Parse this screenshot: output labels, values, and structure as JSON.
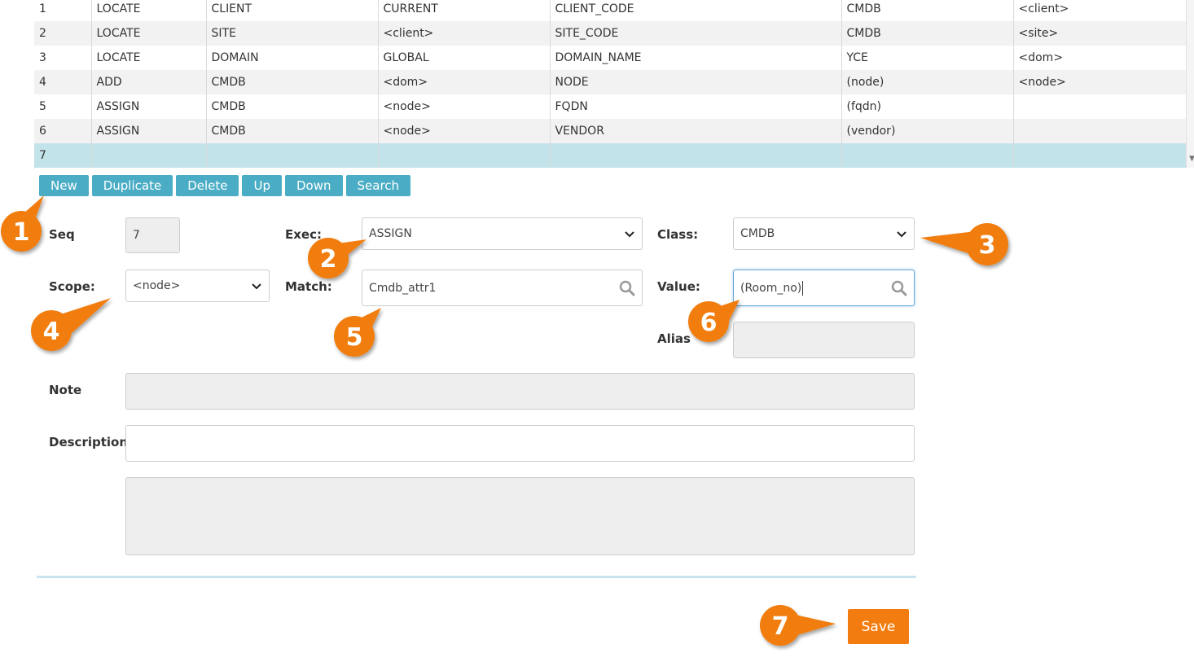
{
  "table": {
    "rows": [
      {
        "seq": "1",
        "exec": "LOCATE",
        "class": "CLIENT",
        "scope": "CURRENT",
        "match": "CLIENT_CODE",
        "value": "CMDB",
        "alias": "<client>"
      },
      {
        "seq": "2",
        "exec": "LOCATE",
        "class": "SITE",
        "scope": "<client>",
        "match": "SITE_CODE",
        "value": "CMDB",
        "alias": "<site>"
      },
      {
        "seq": "3",
        "exec": "LOCATE",
        "class": "DOMAIN",
        "scope": "GLOBAL",
        "match": "DOMAIN_NAME",
        "value": "YCE",
        "alias": "<dom>"
      },
      {
        "seq": "4",
        "exec": "ADD",
        "class": "CMDB",
        "scope": "<dom>",
        "match": "NODE",
        "value": "(node)",
        "alias": "<node>"
      },
      {
        "seq": "5",
        "exec": "ASSIGN",
        "class": "CMDB",
        "scope": "<node>",
        "match": "FQDN",
        "value": "(fqdn)",
        "alias": ""
      },
      {
        "seq": "6",
        "exec": "ASSIGN",
        "class": "CMDB",
        "scope": "<node>",
        "match": "VENDOR",
        "value": "(vendor)",
        "alias": ""
      },
      {
        "seq": "7",
        "exec": "",
        "class": "",
        "scope": "",
        "match": "",
        "value": "",
        "alias": ""
      }
    ],
    "selected_row": 7
  },
  "toolbar": {
    "new": "New",
    "duplicate": "Duplicate",
    "delete": "Delete",
    "up": "Up",
    "down": "Down",
    "search": "Search"
  },
  "form": {
    "seq_label": "Seq",
    "seq_value": "7",
    "exec_label": "Exec:",
    "exec_value": "ASSIGN",
    "class_label": "Class:",
    "class_value": "CMDB",
    "scope_label": "Scope:",
    "scope_value": "<node>",
    "match_label": "Match:",
    "match_value": "Cmdb_attr1",
    "value_label": "Value:",
    "value_value": "(Room_no)",
    "alias_label": "Alias",
    "alias_value": "",
    "note_label": "Note",
    "note_value": "",
    "description_label": "Description",
    "description_value": "",
    "extra_value": ""
  },
  "save_label": "Save",
  "callouts": [
    "1",
    "2",
    "3",
    "4",
    "5",
    "6",
    "7"
  ],
  "colors": {
    "toolbar_button": "#4badc5",
    "save_button": "#f27c10",
    "callout": "#f07d0c",
    "selected_row": "#c3e3ea"
  }
}
